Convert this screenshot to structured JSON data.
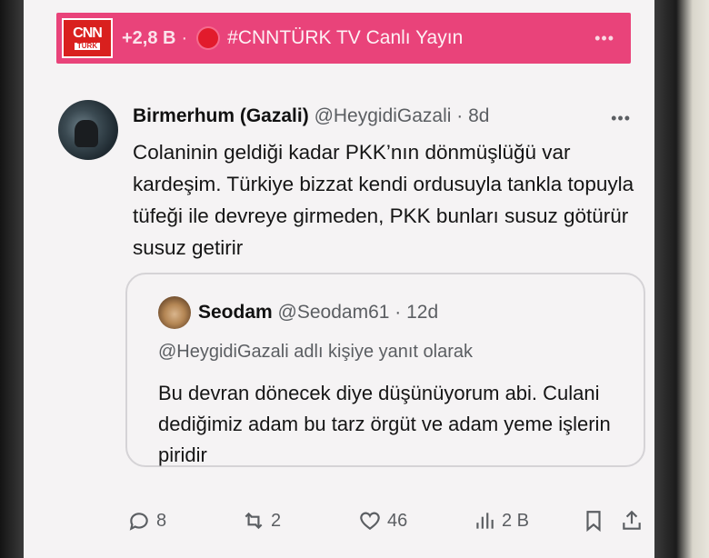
{
  "banner": {
    "brand_line1": "CNN",
    "brand_line2": "TÜRK",
    "count": "+2,8 B",
    "separator": "·",
    "title": "#CNNTÜRK TV Canlı Yayın",
    "more": "•••"
  },
  "tweet": {
    "author": "Birmerhum (Gazali)",
    "handle": "@HeygidiGazali · 8d",
    "more": "•••",
    "text": "Colaninin geldiği kadar PKK’nın dönmüşlüğü var kardeşim. Türkiye bizzat kendi ordusuyla tankla topuyla tüfeği ile devreye girmeden, PKK bunları susuz götürür susuz getirir"
  },
  "quote": {
    "author": "Seodam",
    "handle": "@Seodam61 · 12d",
    "reply_context": "@HeygidiGazali adlı kişiye yanıt olarak",
    "text": "Bu devran dönecek diye düşünüyorum abi. Culani dediğimiz adam bu tarz örgüt ve adam yeme işlerin piridir"
  },
  "actions": {
    "replies": "8",
    "retweets": "2",
    "likes": "46",
    "views": "2 B"
  },
  "colors": {
    "banner": "#e9437a",
    "live_dot": "#e21b2c",
    "muted_text": "#5b5e62"
  }
}
